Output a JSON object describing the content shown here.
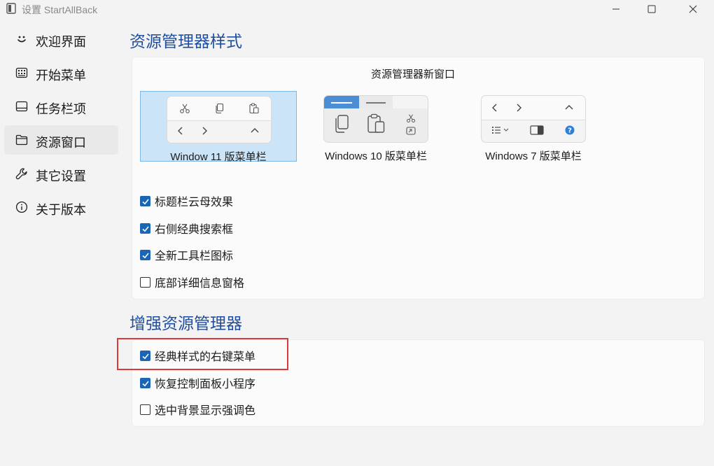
{
  "window": {
    "title": "设置 StartAllBack",
    "minimize_glyph": "—",
    "maximize_glyph": "☐",
    "close_glyph": "✕"
  },
  "sidebar": {
    "items": [
      {
        "label": "欢迎界面",
        "icon": "smile-icon",
        "active": false
      },
      {
        "label": "开始菜单",
        "icon": "start-menu-icon",
        "active": false
      },
      {
        "label": "任务栏项",
        "icon": "taskbar-icon",
        "active": false
      },
      {
        "label": "资源窗口",
        "icon": "folder-icon",
        "active": true
      },
      {
        "label": "其它设置",
        "icon": "wrench-icon",
        "active": false
      },
      {
        "label": "关于版本",
        "icon": "info-icon",
        "active": false
      }
    ]
  },
  "explorer_style": {
    "title": "资源管理器样式",
    "subheading": "资源管理器新窗口",
    "options": [
      {
        "label": "Window 11 版菜单栏",
        "selected": true
      },
      {
        "label": "Windows 10 版菜单栏",
        "selected": false
      },
      {
        "label": "Windows 7 版菜单栏",
        "selected": false
      }
    ],
    "checkboxes": [
      {
        "label": "标题栏云母效果",
        "checked": true
      },
      {
        "label": "右侧经典搜索框",
        "checked": true
      },
      {
        "label": "全新工具栏图标",
        "checked": true
      },
      {
        "label": "底部详细信息窗格",
        "checked": false
      }
    ]
  },
  "enhance": {
    "title": "增强资源管理器",
    "checkboxes": [
      {
        "label": "经典样式的右键菜单",
        "checked": true
      },
      {
        "label": "恢复控制面板小程序",
        "checked": true
      },
      {
        "label": "选中背景显示强调色",
        "checked": false
      }
    ]
  },
  "colors": {
    "accent": "#1a66b5",
    "heading": "#1f4e9e",
    "selection_bg": "#cce4f7",
    "highlight_border": "#e0393c"
  }
}
